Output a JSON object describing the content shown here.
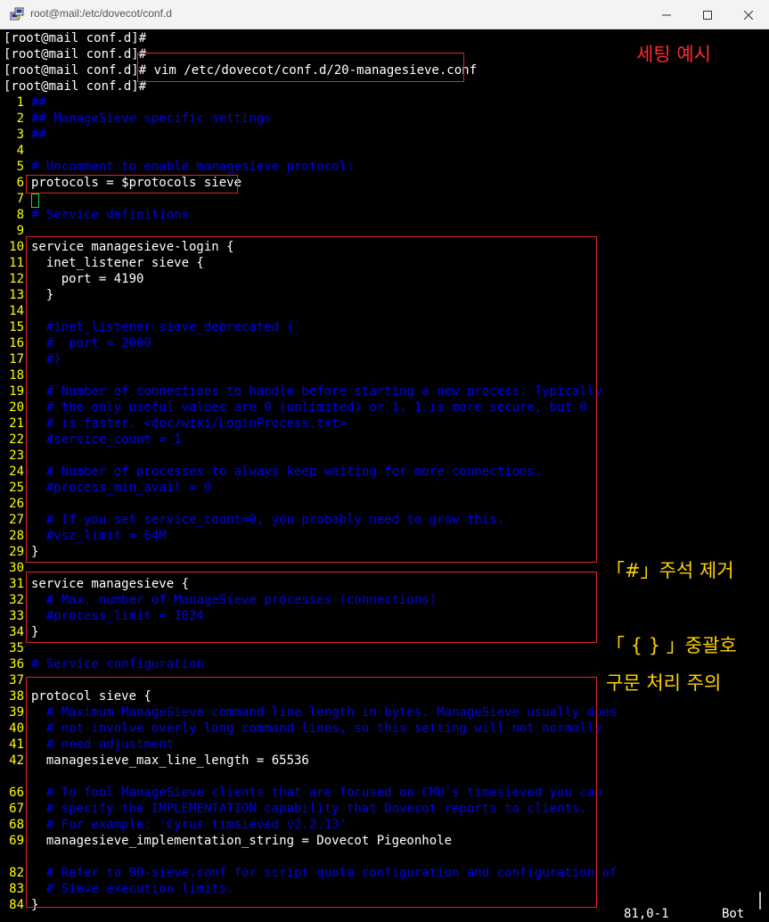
{
  "window": {
    "title": "root@mail:/etc/dovecot/conf.d",
    "icon": "putty-terminal-icon"
  },
  "shell": {
    "lines": [
      "[root@mail conf.d]#",
      "[root@mail conf.d]#",
      "[root@mail conf.d]# vim /etc/dovecot/conf.d/20-managesieve.conf",
      "[root@mail conf.d]#"
    ]
  },
  "editor": {
    "lines": [
      {
        "n": "1",
        "t": "##",
        "comment": true
      },
      {
        "n": "2",
        "t": "## ManageSieve specific settings",
        "comment": true
      },
      {
        "n": "3",
        "t": "##",
        "comment": true
      },
      {
        "n": "4",
        "t": "",
        "comment": false
      },
      {
        "n": "5",
        "t": "# Uncomment to enable managesieve protocol:",
        "comment": true
      },
      {
        "n": "6",
        "t": "protocols = $protocols sieve",
        "comment": false
      },
      {
        "n": "7",
        "t": "",
        "comment": false
      },
      {
        "n": "8",
        "t": "# Service definitions",
        "comment": true
      },
      {
        "n": "9",
        "t": "",
        "comment": false
      },
      {
        "n": "10",
        "t": "service managesieve-login {",
        "comment": false
      },
      {
        "n": "11",
        "t": "  inet_listener sieve {",
        "comment": false
      },
      {
        "n": "12",
        "t": "    port = 4190",
        "comment": false
      },
      {
        "n": "13",
        "t": "  }",
        "comment": false
      },
      {
        "n": "14",
        "t": "",
        "comment": false
      },
      {
        "n": "15",
        "t": "  #inet_listener sieve_deprecated {",
        "comment": true
      },
      {
        "n": "16",
        "t": "  #  port = 2000",
        "comment": true
      },
      {
        "n": "17",
        "t": "  #}",
        "comment": true
      },
      {
        "n": "18",
        "t": "",
        "comment": false
      },
      {
        "n": "19",
        "t": "  # Number of connections to handle before starting a new process. Typically",
        "comment": true
      },
      {
        "n": "20",
        "t": "  # the only useful values are 0 (unlimited) or 1. 1 is more secure, but 0",
        "comment": true
      },
      {
        "n": "21",
        "t": "  # is faster. <doc/wiki/LoginProcess.txt>",
        "comment": true
      },
      {
        "n": "22",
        "t": "  #service_count = 1",
        "comment": true
      },
      {
        "n": "23",
        "t": "",
        "comment": false
      },
      {
        "n": "24",
        "t": "  # Number of processes to always keep waiting for more connections.",
        "comment": true
      },
      {
        "n": "25",
        "t": "  #process_min_avail = 0",
        "comment": true
      },
      {
        "n": "26",
        "t": "",
        "comment": false
      },
      {
        "n": "27",
        "t": "  # If you set service_count=0, you probably need to grow this.",
        "comment": true
      },
      {
        "n": "28",
        "t": "  #vsz_limit = 64M",
        "comment": true
      },
      {
        "n": "29",
        "t": "}",
        "comment": false
      },
      {
        "n": "30",
        "t": "",
        "comment": false
      },
      {
        "n": "31",
        "t": "service managesieve {",
        "comment": false
      },
      {
        "n": "32",
        "t": "  # Max. number of ManageSieve processes (connections)",
        "comment": true
      },
      {
        "n": "33",
        "t": "  #process_limit = 1024",
        "comment": true
      },
      {
        "n": "34",
        "t": "}",
        "comment": false
      },
      {
        "n": "35",
        "t": "",
        "comment": false
      },
      {
        "n": "36",
        "t": "# Service configuration",
        "comment": true
      },
      {
        "n": "37",
        "t": "",
        "comment": false
      },
      {
        "n": "38",
        "t": "protocol sieve {",
        "comment": false
      },
      {
        "n": "39",
        "t": "  # Maximum ManageSieve command line length in bytes. ManageSieve usually does",
        "comment": true
      },
      {
        "n": "40",
        "t": "  # not involve overly long command lines, so this setting will not normally",
        "comment": true
      },
      {
        "n": "41",
        "t": "  # need adjustment",
        "comment": true
      },
      {
        "n": "42",
        "t": "  managesieve_max_line_length = 65536",
        "comment": false
      },
      {
        "n": "",
        "t": "",
        "comment": false
      },
      {
        "n": "66",
        "t": "  # To fool ManageSieve clients that are focused on CMU's timesieved you can",
        "comment": true
      },
      {
        "n": "67",
        "t": "  # specify the IMPLEMENTATION capability that Dovecot reports to clients.",
        "comment": true
      },
      {
        "n": "68",
        "t": "  # For example: 'Cyrus timsieved v2.2.13'",
        "comment": true
      },
      {
        "n": "69",
        "t": "  managesieve_implementation_string = Dovecot Pigeonhole",
        "comment": false
      },
      {
        "n": "",
        "t": "",
        "comment": false
      },
      {
        "n": "82",
        "t": "  # Refer to 90-sieve.conf for script quota configuration and configuration of",
        "comment": true
      },
      {
        "n": "83",
        "t": "  # Sieve execution limits.",
        "comment": true
      },
      {
        "n": "84",
        "t": "}",
        "comment": false
      }
    ]
  },
  "status": {
    "position": "81,0-1",
    "scroll": "Bot"
  },
  "annotations": {
    "example": "세팅 예시",
    "remove_hash": "「#」주석 제거",
    "braces": "「 {  } 」중괄호",
    "syntax_caution": "구문 처리 주의"
  },
  "colors": {
    "highlight_box": "#e0252a",
    "line_number": "#ffff00",
    "comment": "#0000ee",
    "annotation_red": "#ff2a2a",
    "annotation_yellow": "#ffd200"
  }
}
